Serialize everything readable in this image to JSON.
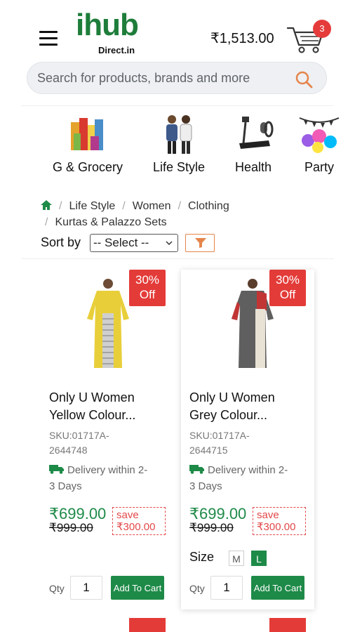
{
  "header": {
    "logo_main": "ihub",
    "logo_sub": "Direct.in",
    "cart_total": "₹1,513.00",
    "cart_count": "3"
  },
  "search": {
    "placeholder": "Search for products, brands and more"
  },
  "categories": [
    {
      "label": "G & Grocery",
      "icon": "grocery-icon"
    },
    {
      "label": "Life Style",
      "icon": "lifestyle-icon"
    },
    {
      "label": "Health",
      "icon": "treadmill-icon"
    },
    {
      "label": "Party",
      "icon": "party-icon"
    }
  ],
  "breadcrumb": {
    "items": [
      "Life Style",
      "Women",
      "Clothing",
      "Kurtas & Palazzo Sets"
    ]
  },
  "sort": {
    "label": "Sort by",
    "selected": "-- Select --"
  },
  "products": [
    {
      "discount_line1": "30%",
      "discount_line2": "Off",
      "name_line1": "Only U Women",
      "name_line2": "Yellow Colour...",
      "sku_line1": "SKU:01717A-",
      "sku_line2": "2644748",
      "delivery_line1": "Delivery within 2-",
      "delivery_line2": "3 Days",
      "price": "₹699.00",
      "mrp": "₹999.00",
      "save_label": "save",
      "save_amount": "₹300.00",
      "qty_label": "Qty",
      "qty": "1",
      "add_label": "Add To Cart"
    },
    {
      "discount_line1": "30%",
      "discount_line2": "Off",
      "name_line1": "Only U Women",
      "name_line2": "Grey Colour...",
      "sku_line1": "SKU:01717A-",
      "sku_line2": "2644715",
      "delivery_line1": "Delivery within 2-",
      "delivery_line2": "3 Days",
      "price": "₹699.00",
      "mrp": "₹999.00",
      "save_label": "save",
      "save_amount": "₹300.00",
      "size_label": "Size",
      "sizes": [
        "M",
        "L"
      ],
      "selected_size": "L",
      "qty_label": "Qty",
      "qty": "1",
      "add_label": "Add To Cart"
    }
  ],
  "colors": {
    "brand_green": "#1e8a48",
    "discount_red": "#e33b38",
    "filter_orange": "#e5854b"
  }
}
